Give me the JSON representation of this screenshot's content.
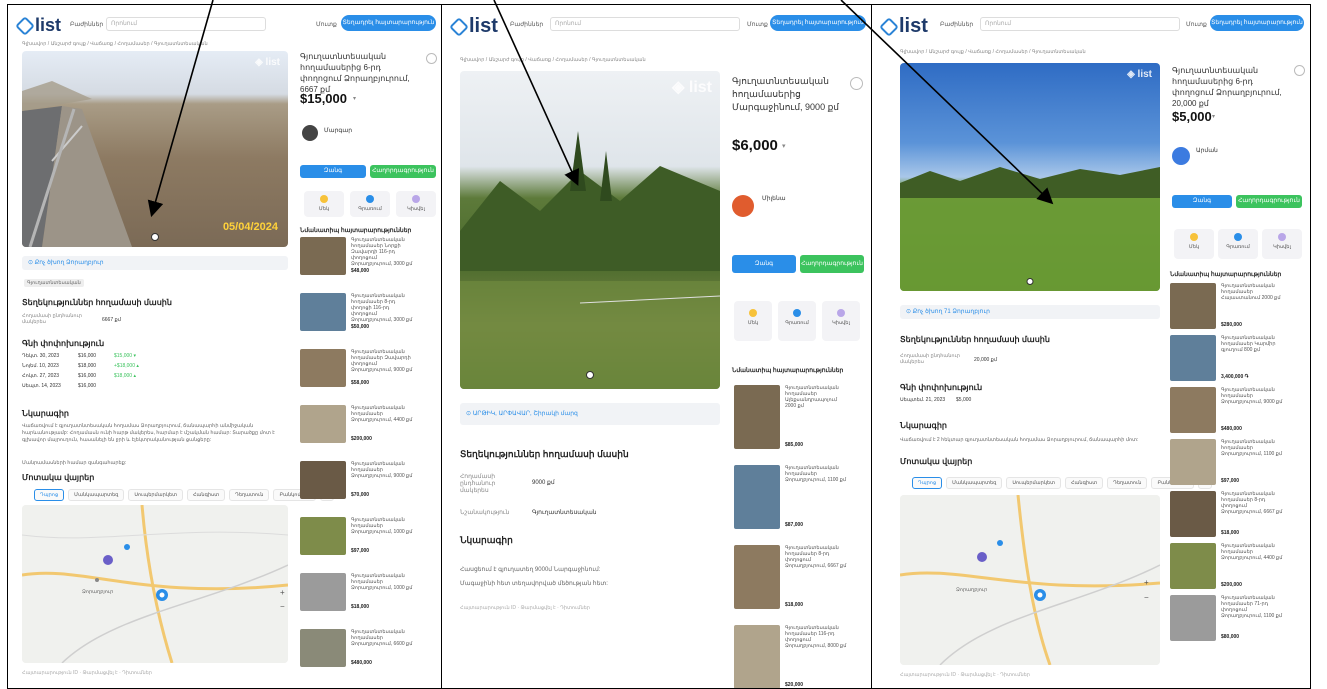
{
  "common": {
    "logo_text": "list",
    "category_label": "Բաժիններ",
    "search_placeholder": "Որոնում",
    "login_label": "Մուտք",
    "post_label": "Տեղադրել հայտարարություն",
    "breadcrumb": "Գլխավոր / Անշարժ գույք / Վաճառք / Հողամասեր / Գյուղատնտեսական",
    "phone_label": "Զանգ",
    "message_label": "Հաղորդագրություն",
    "similar_title": "Նմանատիպ հայտարարություններ",
    "about_title": "Տեղեկություններ հողամասի մասին",
    "desc_title": "Նկարագիր",
    "nearby_title": "Մոտակա վայրեր",
    "area_label": "Հողամասի ընդհանուր մակերես",
    "price_history_title": "Գնի փոփոխություն",
    "act_labels": [
      "Մեկ",
      "Գրառում",
      "Կիսվել"
    ],
    "tabs": [
      "Դպրոց",
      "Մանկապարտեզ",
      "Սուպերմարկետ",
      "Հանգիստ",
      "Դեղատուն",
      "Բանկոմատ"
    ],
    "footer": "Հայտարարություն ID  ·  Թարմացվել է  ·  Դիտումներ"
  },
  "panel1": {
    "title": "Գյուղատնտեսական հողամասերից 6-րդ փողոցում Ձորաղբյուրում, 6667 քմ",
    "price": "$15,000",
    "seller": "Մարգար",
    "date_stamp": "05/04/2024",
    "location": "Քոչ ծխող Ձորաղբյուր",
    "badge": "Գյուղատնտեսական",
    "area_value": "6667 քմ",
    "history": [
      {
        "date": "Դեկտ. 30, 2023",
        "old": "$16,000",
        "new": "$15,000 ▾"
      },
      {
        "date": "Նոյեմ. 10, 2023",
        "old": "$18,000",
        "new": "+$18,000 ▴"
      },
      {
        "date": "Հոկտ. 27, 2023",
        "old": "$16,000",
        "new": "$18,000 ▴"
      },
      {
        "date": "Սեպտ. 14, 2023",
        "old": "$16,000",
        "new": ""
      }
    ],
    "description": "Վաճառվում է գյուղատնտեսական հողամաս Ձորաղբյուրում, ճանապարհի անմիջական հարևանությամբ: Հողամասն ունի հարթ մակերես, հարմար է մշակման համար: Տարածքը մոտ է գլխավոր մայրուղուն, հասանելի են ջրի և էլեկտրականության ցանցերը:",
    "description_tail": "Մանրամասների համար զանգահարեք:",
    "similar": [
      {
        "text": "Գյուղատնտեսական հողամասեր Նորքի Զավարդի 116-րդ փողոցում Ձորաղբյուրում, 3000 քմ",
        "price": "$48,000"
      },
      {
        "text": "Գյուղատնտեսական հողամասեր 8-րդ փողոցի 116-րդ փողոցում Ձորաղբյուրում, 3000 քմ",
        "price": "$50,000"
      },
      {
        "text": "Գյուղատնտեսական հողամասեր Զավարդի փողոցում Ձորաղբյուրում, 9000 քմ",
        "price": "$58,000"
      },
      {
        "text": "Գյուղատնտեսական հողամասեր Ձորաղբյուրում, 4400 քմ",
        "price": "$200,000"
      },
      {
        "text": "Գյուղատնտեսական հողամասեր Ձորաղբյուրում, 9000 քմ",
        "price": "$70,000"
      },
      {
        "text": "Գյուղատնտեսական հողամասեր Ձորաղբյուրում, 1000 քմ",
        "price": "$97,000"
      },
      {
        "text": "Գյուղատնտեսական հողամասեր Ձորաղբյուրում, 1000 քմ",
        "price": "$18,000"
      },
      {
        "text": "Գյուղատնտեսական հողամասեր Ձորաղբյուրում, 6600 քմ",
        "price": "$480,000"
      }
    ]
  },
  "panel2": {
    "title": "Գյուղատնտեսական հողամասերից Մարգաջինում, 9000 քմ",
    "price": "$6,000",
    "seller": "Միլենա",
    "location": "ԱՐԹԻԿ, ԱՐՓԱՎԱՐ, Շիրակի մարզ",
    "area_value": "9000 քմ",
    "purpose_label": "Նշանակություն",
    "purpose_value": "Գյուղատնտեսական",
    "description": "Հասցեում է գյուղատեղ 9000մ Նարգաջինում:",
    "description2": "Մագաջինի հետ տեղավորված մեծության հետ:",
    "footer_text": "Հայտարարություն ID  ·  Թարմացվել է  ·  Դիտումներ",
    "similar": [
      {
        "text": "Գյուղատնտեսական հողամասեր Ալեքսանդրապոլում 2000 քմ",
        "price": "$85,000"
      },
      {
        "text": "Գյուղատնտեսական հողամասեր Ձորաղբյուրում, 1100 քմ",
        "price": "$87,000"
      },
      {
        "text": "Գյուղատնտեսական հողամասեր 8-րդ փողոցում Ձորաղբյուրում, 6667 քմ",
        "price": "$18,000"
      },
      {
        "text": "Գյուղատնտեսական հողամասեր 116-րդ փողոցում Ձորաղբյուրում, 8000 քմ",
        "price": "$20,000"
      }
    ]
  },
  "panel3": {
    "title": "Գյուղատնտեսական հողամասերից 6-րդ փողոցում Ձորաղբյուրում, 20,000 քմ",
    "price": "$5,000",
    "seller": "Արման",
    "location": "Քոչ ծխող 71 Ձորաղբյուր",
    "area_value": "20,000 քմ",
    "history": [
      {
        "date": "Սեպտեմ. 21, 2023",
        "old": "$5,000",
        "new": ""
      }
    ],
    "description": "Վաճառվում է 2 հեկտար գյուղատնտեսական հողամաս Ձորաղբյուրում, ճանապարհի մոտ:",
    "similar": [
      {
        "text": "Գյուղատնտեսական հողամասեր Հայաստանում 2000 քմ",
        "price": "$280,000"
      },
      {
        "text": "Գյուղատնտեսական հողամասեր Կարմիր գյուղում 800 քմ",
        "price": "3,400,000 ֏"
      },
      {
        "text": "Գյուղատնտեսական հողամասեր Ձորաղբյուրում, 9000 քմ",
        "price": "$480,000"
      },
      {
        "text": "Գյուղատնտեսական հողամասեր Ձորաղբյուրում, 1100 քմ",
        "price": "$97,000"
      },
      {
        "text": "Գյուղատնտեսական հողամասեր 8-րդ փողոցում Ձորաղբյուրում, 6667 քմ",
        "price": "$18,000"
      },
      {
        "text": "Գյուղատնտեսական հողամասեր Ձորաղբյուրում, 4400 քմ",
        "price": "$200,000"
      },
      {
        "text": "Գյուղատնտեսական հողամասեր 71-րդ փողոցում Ձորաղբյուրում, 1100 քմ",
        "price": "$80,000"
      },
      {
        "text": "Գյուղատնտեսական հողամասեր Ձորաղբյուրում",
        "price": ""
      }
    ]
  },
  "colors": {
    "accent": "#2a8ee8",
    "green": "#3cc35e",
    "dark": "#1e3a6a"
  }
}
